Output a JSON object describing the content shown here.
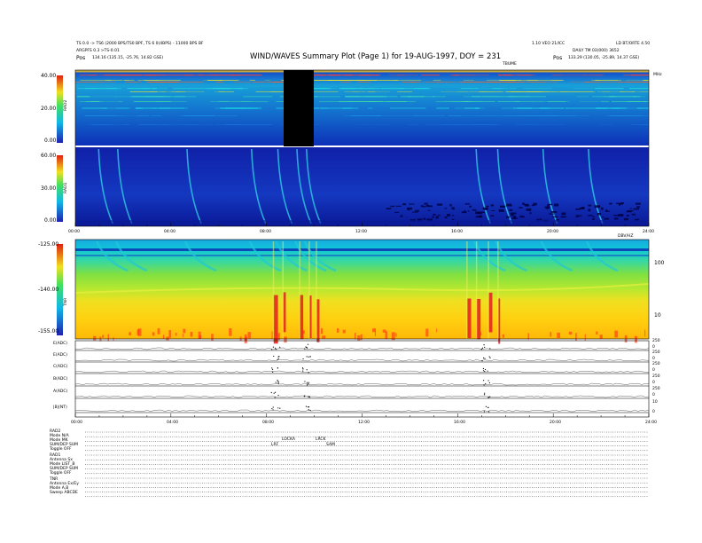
{
  "header": {
    "title": "WIND/WAVES Summary Plot (Page 1) for 19-AUG-1997, DOY = 231",
    "left_line1": "TS 0.0 -> TS6 (2000 BPS/TS0 BPF, TS 6 0(4BPS) - 11000 BPS BF",
    "left_line2": "ARGPFS 0.3 >TS-0.01",
    "left_pos_label": "Pos",
    "left_pos_value": "134.16 (135.15, -25.76, 14.82 GSE)",
    "right_line1": "LD BT/ORTE 4.50",
    "right_line2": "DAILY TM 03(000) 3652",
    "right_pos_label": "Pos",
    "right_pos_value": "133.29 (130.05, -25.89, 14.37 GSE)",
    "center_small": "1.10 VEO 21/ICC"
  },
  "panels": {
    "rad2": {
      "label": "RAD2",
      "unit": "MHz",
      "top_label": "TBUME",
      "ticks": [
        "40.00",
        "20.00",
        "0.00"
      ]
    },
    "rad1": {
      "label": "RAD1",
      "ticks": [
        "60.00",
        "30.00",
        "0.00"
      ]
    },
    "tnr": {
      "label": "TNR",
      "top_label": "DBV/HZ",
      "ticks": [
        "-125.00",
        "-140.00",
        "-155.00"
      ],
      "right_ticks": [
        "100",
        "10"
      ]
    },
    "time_axis_1": [
      "00:00",
      "04:00",
      "08:00",
      "12:00",
      "16:00",
      "20:00",
      "24:00"
    ],
    "time_axis_2": [
      "00:00",
      "04:00",
      "08:00",
      "12:00",
      "16:00",
      "20:00",
      "24:00"
    ]
  },
  "tds": {
    "rows": [
      {
        "label": "E(ADC)",
        "right": [
          "250",
          "0"
        ]
      },
      {
        "label": "E(ADC)",
        "right": [
          "250",
          "0"
        ]
      },
      {
        "label": "C(ADC)",
        "right": [
          "250",
          "0"
        ]
      },
      {
        "label": "B(ADC)",
        "right": [
          "250",
          "0"
        ]
      },
      {
        "label": "A(ADC)",
        "right": [
          "250",
          "0"
        ]
      },
      {
        "label": "|B|(NT)",
        "right": [
          "10",
          "0"
        ]
      }
    ]
  },
  "status": {
    "rad2_head": "RAD2",
    "rad2_lines": [
      "Mode   N/A",
      "Mode    MK",
      "SUM/DEP SUM",
      "Toggle   OFF"
    ],
    "rad1_head": "RAD1",
    "rad1_lines": [
      "Antenna   Sx",
      "Mode  LIST_B",
      "SUM/DEP SUM",
      "Toggle   OFF"
    ],
    "tnr_head": "TNR",
    "tnr_lines": [
      "Antenna  Ex/Ey",
      "Mode    A,B",
      "Sweep  ABCDE"
    ],
    "annotations": [
      {
        "text": "LOCKA"
      },
      {
        "text": "LRF"
      },
      {
        "text": "LRCK"
      },
      {
        "text": "SAM"
      }
    ]
  },
  "chart_data": {
    "type": "heatmap",
    "title": "WIND/WAVES Summary Plot (Page 1) for 19-AUG-1997, DOY = 231",
    "x": {
      "label": "",
      "range": [
        0,
        24
      ],
      "ticks": [
        "00:00",
        "04:00",
        "08:00",
        "12:00",
        "16:00",
        "20:00",
        "24:00"
      ]
    },
    "panels": [
      {
        "name": "RAD2",
        "ylim": [
          0,
          40
        ],
        "yticks": [
          0,
          20,
          40
        ],
        "datagap_hours": [
          7.4,
          9.5
        ]
      },
      {
        "name": "RAD1",
        "ylim": [
          0,
          60
        ],
        "yticks": [
          0,
          30,
          60
        ]
      },
      {
        "name": "TNR",
        "ylim": [
          -155,
          -125
        ],
        "yticks": [
          -155,
          -140,
          -125
        ]
      }
    ],
    "burst_hours": [
      0.9,
      1.7,
      4.6,
      7.3,
      8.4,
      9.2,
      9.6,
      16.7,
      17.6,
      19.5,
      21.4
    ],
    "colors": {
      "low": "#0a1aa8",
      "mid": "#18d4d0",
      "high": "#ffe000",
      "peak": "#e01010"
    }
  }
}
